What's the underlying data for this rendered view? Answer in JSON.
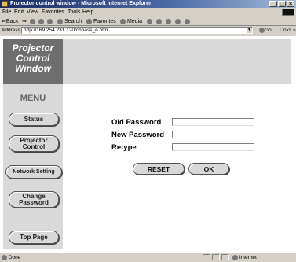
{
  "window": {
    "title": "Projector control window - Microsoft Internet Explorer",
    "buttons": [
      "_",
      "□",
      "×"
    ]
  },
  "menubar": [
    "File",
    "Edit",
    "View",
    "Favorites",
    "Tools",
    "Help"
  ],
  "toolbar": {
    "back": "⇐Back",
    "forward": "⇒",
    "search": "Search",
    "favorites": "Favorites",
    "media": "Media"
  },
  "address": {
    "label": "Address",
    "url": "http://169.254.231.120/chpass_e.htm",
    "go": "Go",
    "links": "Links »"
  },
  "logo": [
    "Projector",
    "Control",
    "Window"
  ],
  "nav": {
    "heading": "MENU",
    "items": [
      {
        "id": "status",
        "label": "Status"
      },
      {
        "id": "projector-control",
        "label": "Projector Control"
      },
      {
        "id": "network-setting",
        "label": "Network Setting"
      },
      {
        "id": "change-password",
        "label": "Change Password"
      },
      {
        "id": "top-page",
        "label": "Top Page"
      }
    ]
  },
  "form": {
    "fields": [
      {
        "label": "Old Password",
        "value": ""
      },
      {
        "label": "New Password",
        "value": ""
      },
      {
        "label": "Retype",
        "value": ""
      }
    ],
    "reset": "RESET",
    "ok": "OK"
  },
  "status": {
    "left": "Done",
    "zone": "Internet"
  },
  "colors": {
    "titlebar": "#1c2a63",
    "logo": "#6e6e6e",
    "panel": "#d9d9d9",
    "chrome": "#d4d0c8"
  }
}
